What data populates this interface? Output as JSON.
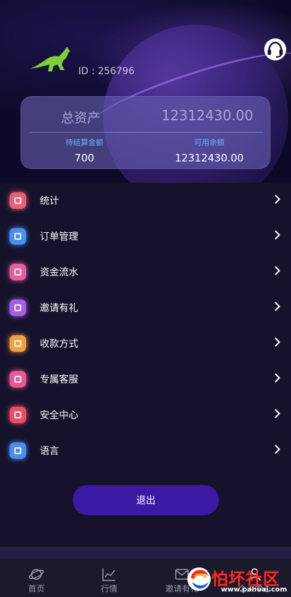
{
  "header": {
    "user_id": "ID : 256796",
    "logo": "kangaroo-logo",
    "support_icon": "headset-icon"
  },
  "assets": {
    "total_label": "总资产",
    "total_value": "12312430.00",
    "pending_label": "待结算金额",
    "pending_value": "700",
    "available_label": "可用余额",
    "available_value": "12312430.00"
  },
  "menu": {
    "items": [
      {
        "label": "统计",
        "icon": "chart-icon",
        "color": "#e8607a"
      },
      {
        "label": "订单管理",
        "icon": "order-icon",
        "color": "#4a8ff0"
      },
      {
        "label": "资金流水",
        "icon": "funds-icon",
        "color": "#e4609c"
      },
      {
        "label": "邀请有礼",
        "icon": "invite-icon",
        "color": "#a660e8"
      },
      {
        "label": "收款方式",
        "icon": "payment-icon",
        "color": "#f0a040"
      },
      {
        "label": "专属客服",
        "icon": "service-icon",
        "color": "#e85a96"
      },
      {
        "label": "安全中心",
        "icon": "shield-icon",
        "color": "#e8506a"
      },
      {
        "label": "语言",
        "icon": "language-icon",
        "color": "#4a8ff0"
      }
    ]
  },
  "logout_label": "退出",
  "tabbar": {
    "tabs": [
      {
        "label": "首页",
        "icon": "planet-icon"
      },
      {
        "label": "行情",
        "icon": "market-chart-icon"
      },
      {
        "label": "邀请有礼",
        "icon": "share-icon"
      },
      {
        "label": "个人中心",
        "icon": "user-icon"
      }
    ]
  },
  "watermark": {
    "text": "怕坏社区",
    "url": "www.pahuai.com"
  },
  "colors": {
    "background": "#13102a",
    "card": "#6860b0",
    "accent_blue": "#6fb0ff",
    "logout": "#3b1aa6"
  }
}
